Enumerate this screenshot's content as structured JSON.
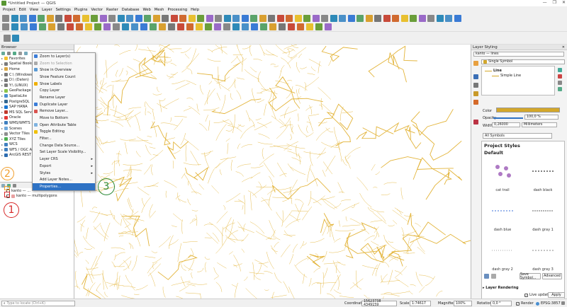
{
  "window": {
    "title": "*Untitled Project — QGIS",
    "controls": [
      "—",
      "❐",
      "✕"
    ]
  },
  "menubar": [
    "Project",
    "Edit",
    "View",
    "Layer",
    "Settings",
    "Plugins",
    "Vector",
    "Raster",
    "Database",
    "Web",
    "Mesh",
    "Processing",
    "Help"
  ],
  "browser": {
    "title": "Browser",
    "items": [
      {
        "label": "Favorites",
        "color": "#f2c230"
      },
      {
        "label": "Spatial Bookm",
        "color": "#7a7a7a"
      },
      {
        "label": "Home",
        "color": "#d9a642"
      },
      {
        "label": "C:\\ (Windows)",
        "color": "#7a7a7a"
      },
      {
        "label": "D:\\ (Daten)",
        "color": "#7a7a7a"
      },
      {
        "label": "Y:\\ (LINUX)",
        "color": "#7a7a7a"
      },
      {
        "label": "GeoPackage",
        "color": "#8bc34a"
      },
      {
        "label": "SpatiaLite",
        "color": "#4a8fd1"
      },
      {
        "label": "PostgreSQL",
        "color": "#336791"
      },
      {
        "label": "SAP HANA",
        "color": "#1976d2"
      },
      {
        "label": "MS SQL Serve",
        "color": "#c0392b"
      },
      {
        "label": "Oracle",
        "color": "#e53935"
      },
      {
        "label": "WMS/WMTS",
        "color": "#3f7fbf"
      },
      {
        "label": "Scenes",
        "color": "#6fa8dc"
      },
      {
        "label": "Vector Tiles",
        "color": "#8e8e8e"
      },
      {
        "label": "XYZ Tiles",
        "color": "#4caf50"
      },
      {
        "label": "WCS",
        "color": "#3f7fbf"
      },
      {
        "label": "WFS / OGC A",
        "color": "#3f7fbf"
      },
      {
        "label": "ArcGIS REST S",
        "color": "#2b6cb0"
      }
    ]
  },
  "layers": {
    "items": [
      {
        "label": "kanto — ..."
      },
      {
        "label": "kanto — multipolygons"
      }
    ]
  },
  "context_menu": {
    "items": [
      {
        "label": "Zoom to Layer(s)",
        "disabled": false,
        "color": "#3b7dd8"
      },
      {
        "label": "Zoom to Selection",
        "disabled": true,
        "color": "#aaaaaa"
      },
      {
        "label": "Show in Overview",
        "disabled": false,
        "color": "#5b9bd5"
      },
      {
        "label": "Show Feature Count",
        "disabled": false,
        "color": ""
      },
      {
        "label": "Show Labels",
        "disabled": false,
        "color": "#f0b000"
      },
      {
        "label": "Copy Layer",
        "disabled": false,
        "color": ""
      },
      {
        "label": "Rename Layer",
        "disabled": false,
        "color": ""
      },
      {
        "label": "Duplicate Layer",
        "disabled": false,
        "color": "#3b7dd8"
      },
      {
        "label": "Remove Layer...",
        "disabled": false,
        "color": "#d9534f"
      },
      {
        "label": "Move to Bottom",
        "disabled": false,
        "color": ""
      },
      {
        "label": "Open Attribute Table",
        "disabled": false,
        "color": "#7fb3e0"
      },
      {
        "label": "Toggle Editing",
        "disabled": false,
        "color": "#f0c000"
      },
      {
        "label": "Filter...",
        "disabled": false,
        "color": ""
      },
      {
        "label": "Change Data Source...",
        "disabled": false,
        "color": ""
      },
      {
        "label": "Set Layer Scale Visibility...",
        "disabled": false,
        "color": ""
      },
      {
        "label": "Layer CRS",
        "disabled": false,
        "color": "",
        "submenu": true
      },
      {
        "label": "Export",
        "disabled": false,
        "color": "",
        "submenu": true
      },
      {
        "label": "Styles",
        "disabled": false,
        "color": "",
        "submenu": true
      },
      {
        "label": "Add Layer Notes...",
        "disabled": false,
        "color": ""
      },
      {
        "label": "Properties...",
        "disabled": false,
        "color": "",
        "highlighted": true
      }
    ],
    "submenu_arrow": "▸"
  },
  "annotations": [
    {
      "number": "2",
      "color": "#f0a030"
    },
    {
      "number": "1",
      "color": "#d62828"
    },
    {
      "number": "3",
      "color": "#2e8b3a"
    }
  ],
  "layer_styling": {
    "title": "Layer Styling",
    "layer_select": "kanto — lines",
    "renderer": "Single Symbol",
    "tree_line": "Line",
    "tree_simple": "Simple Line",
    "color_label": "Color",
    "color_value": "#d4a82a",
    "opacity_label": "Opacity",
    "opacity_value": "100,0 %",
    "width_label": "Width",
    "width_value": "0,26000",
    "width_unit": "Millimeters",
    "symbols_filter": "All Symbols",
    "project_styles": "Project Styles",
    "default_label": "Default",
    "symbols": [
      "cat trail",
      "dash  black",
      "dash blue",
      "dash gray 1",
      "dash gray 2",
      "dash gray 3"
    ],
    "save_symbol": "Save Symbol...",
    "advanced": "Advanced",
    "layer_rendering": "Layer Rendering",
    "live_update": "Live update",
    "apply": "Apply"
  },
  "statusbar": {
    "search_placeholder": "Type to locate (Ctrl+K)",
    "coordinate_label": "Coordinate",
    "coordinate_value": "15623738  4349159",
    "scale_label": "Scale",
    "scale_value": "1:74617",
    "magnifier_label": "Magnifier",
    "magnifier_value": "100%",
    "rotation_label": "Rotation",
    "rotation_value": "0,0 °",
    "render_label": "Render",
    "epsg": "EPSG:3857"
  },
  "map": {
    "line_color": "#e3b43a"
  }
}
